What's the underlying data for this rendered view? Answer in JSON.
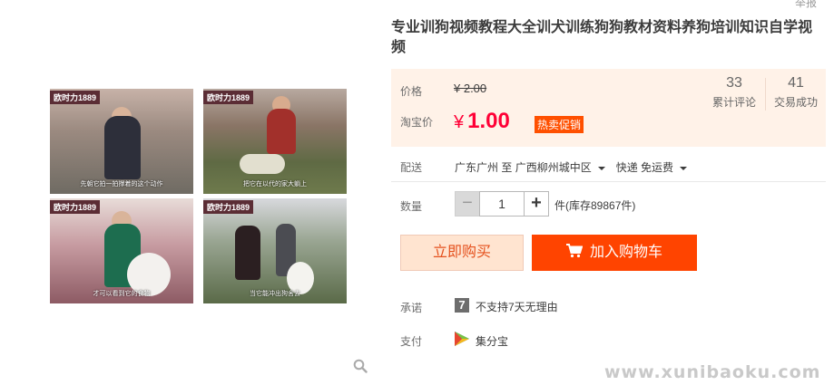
{
  "header": {
    "report_link": "举报"
  },
  "gallery": {
    "thumbs": [
      {
        "tag": "欧时力1889",
        "caption": "先朝它拍一拍撑着的这个动作"
      },
      {
        "tag": "欧时力1889",
        "caption": "把它在以代的家大躺上"
      },
      {
        "tag": "欧时力1889",
        "caption": "才可以看到它的食物"
      },
      {
        "tag": "欧时力1889",
        "caption": "当它能冲出狗舍去"
      }
    ],
    "zoom_icon": "magnifier-icon"
  },
  "product": {
    "title": "专业训狗视频教程大全训犬训练狗狗教材资料养狗培训知识自学视频"
  },
  "price": {
    "orig_label": "价格",
    "orig_value": "¥ 2.00",
    "taobao_label": "淘宝价",
    "currency": "¥",
    "current_value": "1.00",
    "promo_badge": "热卖促销",
    "reviews_count": "33",
    "reviews_label": "累计评论",
    "sales_count": "41",
    "sales_label": "交易成功"
  },
  "shipping": {
    "label": "配送",
    "from": "广东广州 至",
    "to": "广西柳州城中区",
    "method": "快递 免运费"
  },
  "quantity": {
    "label": "数量",
    "minus": "−",
    "value": "1",
    "plus": "+",
    "stock": "件(库存89867件)"
  },
  "actions": {
    "buy_now": "立即购买",
    "add_to_cart": "加入购物车"
  },
  "promise": {
    "label": "承诺",
    "icon_text": "7",
    "text": "不支持7天无理由"
  },
  "payment": {
    "label": "支付",
    "text": "集分宝"
  },
  "footer": {
    "site_watermark": "www.xunibaoku.com"
  },
  "colors": {
    "price_red": "#ff0036",
    "cart_orange": "#ff4400",
    "buy_bg": "#ffe4d0",
    "promo_bg": "#ff5000"
  }
}
